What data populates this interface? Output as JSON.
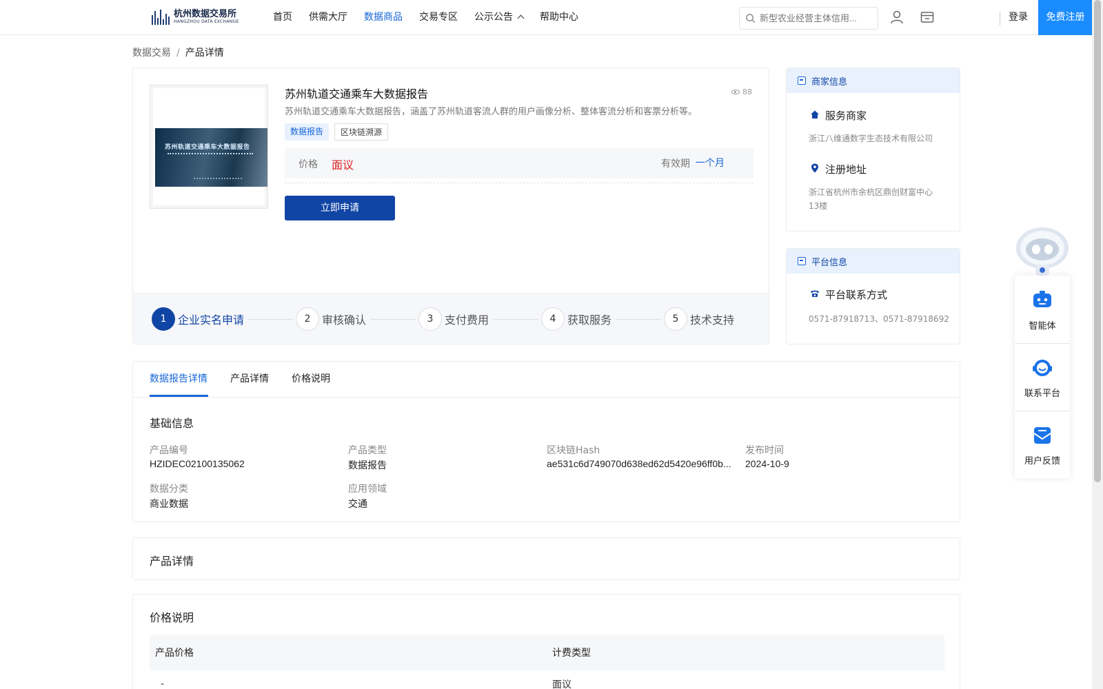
{
  "header": {
    "logo_main": "杭州数据交易所",
    "logo_sub": "HANGZHOU DATA EXCHANGE",
    "nav": [
      "首页",
      "供需大厅",
      "数据商品",
      "交易专区",
      "公示公告",
      "帮助中心"
    ],
    "active_nav": "数据商品",
    "search_placeholder": "新型农业经营主体信用...",
    "login": "登录",
    "register": "免费注册"
  },
  "breadcrumb": {
    "root": "数据交易",
    "separator": "/",
    "current": "产品详情"
  },
  "product": {
    "title": "苏州轨道交通乘车大数据报告",
    "views": "88",
    "description": "苏州轨道交通乘车大数据报告，涵盖了苏州轨道客流人群的用户画像分析、整体客流分析和客票分析等。",
    "tags": [
      "数据报告",
      "区块链溯源"
    ],
    "price_label": "价格",
    "price_value": "面议",
    "validity_label": "有效期",
    "validity_value": "一个月",
    "apply_button": "立即申请",
    "thumb_title": "苏州轨道交通乘车大数据报告",
    "steps": [
      {
        "num": "1",
        "label": "企业实名申请"
      },
      {
        "num": "2",
        "label": "审核确认"
      },
      {
        "num": "3",
        "label": "支付费用"
      },
      {
        "num": "4",
        "label": "获取服务"
      },
      {
        "num": "5",
        "label": "技术支持"
      }
    ]
  },
  "merchant": {
    "heading": "商家信息",
    "service_label": "服务商家",
    "service_value": "浙江八维通数字生态技术有限公司",
    "address_label": "注册地址",
    "address_line1": "浙江省杭州市余杭区鼎创财富中心",
    "address_line2": "13楼"
  },
  "platform": {
    "heading": "平台信息",
    "contact_label": "平台联系方式",
    "contact_value": "0571-87918713、0571-87918692"
  },
  "float_panel": {
    "items": [
      "智能体",
      "联系平台",
      "用户反馈"
    ]
  },
  "tabs": {
    "items": [
      "数据报告详情",
      "产品详情",
      "价格说明"
    ],
    "active": "数据报告详情"
  },
  "basic_info": {
    "title": "基础信息",
    "fields": [
      {
        "label": "产品编号",
        "value": "HZIDEC02100135062"
      },
      {
        "label": "产品类型",
        "value": "数据报告"
      },
      {
        "label": "区块链Hash",
        "value": "ae531c6d749070d638ed62d5420e96ff0b..."
      },
      {
        "label": "发布时间",
        "value": "2024-10-9"
      },
      {
        "label": "数据分类",
        "value": "商业数据"
      },
      {
        "label": "应用领域",
        "value": "交通"
      }
    ]
  },
  "product_detail": {
    "title": "产品详情"
  },
  "price_section": {
    "title": "价格说明",
    "columns": [
      "产品价格",
      "计费类型"
    ],
    "row": [
      "-",
      "面议"
    ]
  },
  "colors": {
    "primary": "#1145a5",
    "accent": "#1565d8",
    "register": "#1a8cff",
    "price": "#e02020"
  }
}
